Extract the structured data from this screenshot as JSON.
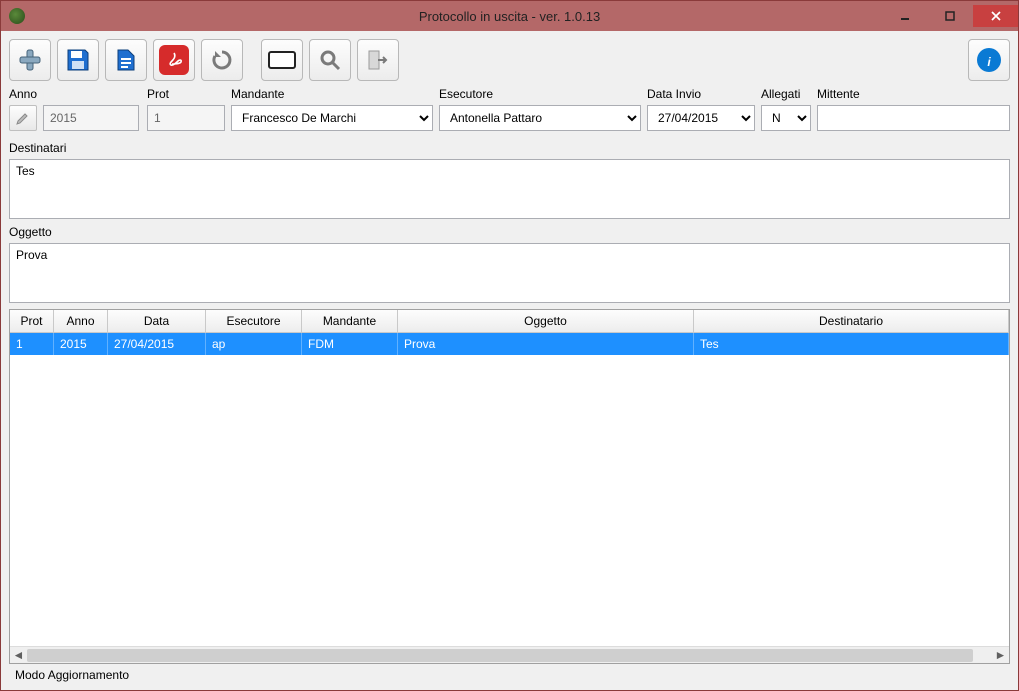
{
  "window": {
    "title": "Protocollo in uscita - ver. 1.0.13"
  },
  "toolbar": {
    "items": {
      "add": "add",
      "save": "save",
      "document": "document",
      "pdf": "pdf",
      "refresh": "refresh",
      "view": "view",
      "search": "search",
      "export": "export",
      "info": "info"
    }
  },
  "labels": {
    "anno": "Anno",
    "prot": "Prot",
    "mandante": "Mandante",
    "esecutore": "Esecutore",
    "data_invio": "Data Invio",
    "allegati": "Allegati",
    "mittente": "Mittente",
    "destinatari": "Destinatari",
    "oggetto": "Oggetto"
  },
  "form": {
    "anno": "2015",
    "prot": "1",
    "mandante_options": [
      "Francesco De Marchi"
    ],
    "mandante": "Francesco De Marchi",
    "esecutore_options": [
      "Antonella Pattaro"
    ],
    "esecutore": "Antonella Pattaro",
    "data_invio_options": [
      "27/04/2015"
    ],
    "data_invio": "27/04/2015",
    "allegati_options": [
      "N"
    ],
    "allegati": "N",
    "mittente": "",
    "destinatari": "Tes",
    "oggetto": "Prova"
  },
  "grid": {
    "headers": {
      "prot": "Prot",
      "anno": "Anno",
      "data": "Data",
      "esecutore": "Esecutore",
      "mandante": "Mandante",
      "oggetto": "Oggetto",
      "destinatario": "Destinatario"
    },
    "rows": [
      {
        "prot": "1",
        "anno": "2015",
        "data": "27/04/2015",
        "esecutore": "ap",
        "mandante": "FDM",
        "oggetto": "Prova",
        "destinatario": "Tes"
      }
    ]
  },
  "status": "Modo Aggiornamento"
}
